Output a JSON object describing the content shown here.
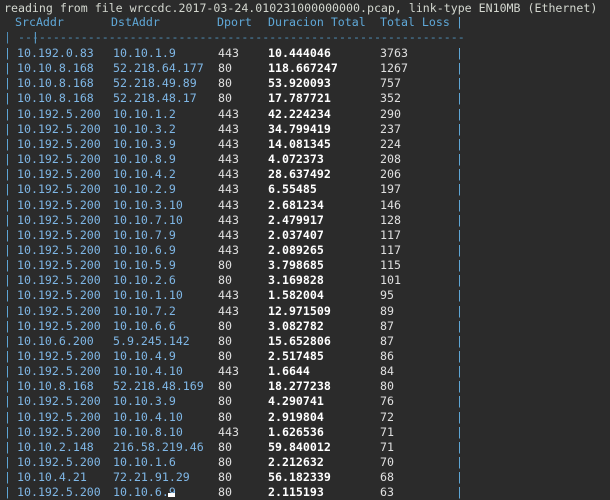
{
  "terminal": {
    "status_line": "reading from file wrccdc.2017-03-24.010231000000000.pcap, link-type EN10MB (Ethernet)",
    "separator": "| -------------------------------------------------------------------------------- |"
  },
  "table": {
    "headers": {
      "src": "SrcAddr",
      "dst": "DstAddr",
      "port": "Dport",
      "dur": "Duracion Total",
      "loss": "Total Loss"
    },
    "rows": [
      {
        "src": "10.192.0.83",
        "dst": "10.10.1.9",
        "port": "443",
        "dur": "10.444046",
        "loss": "3763"
      },
      {
        "src": "10.10.8.168",
        "dst": "52.218.64.177",
        "port": "80",
        "dur": "118.667247",
        "loss": "1267"
      },
      {
        "src": "10.10.8.168",
        "dst": "52.218.49.89",
        "port": "80",
        "dur": "53.920093",
        "loss": "757"
      },
      {
        "src": "10.10.8.168",
        "dst": "52.218.48.17",
        "port": "80",
        "dur": "17.787721",
        "loss": "352"
      },
      {
        "src": "10.192.5.200",
        "dst": "10.10.1.2",
        "port": "443",
        "dur": "42.224234",
        "loss": "290"
      },
      {
        "src": "10.192.5.200",
        "dst": "10.10.3.2",
        "port": "443",
        "dur": "34.799419",
        "loss": "237"
      },
      {
        "src": "10.192.5.200",
        "dst": "10.10.3.9",
        "port": "443",
        "dur": "14.081345",
        "loss": "224"
      },
      {
        "src": "10.192.5.200",
        "dst": "10.10.8.9",
        "port": "443",
        "dur": "4.072373",
        "loss": "208"
      },
      {
        "src": "10.192.5.200",
        "dst": "10.10.4.2",
        "port": "443",
        "dur": "28.637492",
        "loss": "206"
      },
      {
        "src": "10.192.5.200",
        "dst": "10.10.2.9",
        "port": "443",
        "dur": "6.55485",
        "loss": "197"
      },
      {
        "src": "10.192.5.200",
        "dst": "10.10.3.10",
        "port": "443",
        "dur": "2.681234",
        "loss": "146"
      },
      {
        "src": "10.192.5.200",
        "dst": "10.10.7.10",
        "port": "443",
        "dur": "2.479917",
        "loss": "128"
      },
      {
        "src": "10.192.5.200",
        "dst": "10.10.7.9",
        "port": "443",
        "dur": "2.037407",
        "loss": "117"
      },
      {
        "src": "10.192.5.200",
        "dst": "10.10.6.9",
        "port": "443",
        "dur": "2.089265",
        "loss": "117"
      },
      {
        "src": "10.192.5.200",
        "dst": "10.10.5.9",
        "port": "80",
        "dur": "3.798685",
        "loss": "115"
      },
      {
        "src": "10.192.5.200",
        "dst": "10.10.2.6",
        "port": "80",
        "dur": "3.169828",
        "loss": "101"
      },
      {
        "src": "10.192.5.200",
        "dst": "10.10.1.10",
        "port": "443",
        "dur": "1.582004",
        "loss": "95"
      },
      {
        "src": "10.192.5.200",
        "dst": "10.10.7.2",
        "port": "443",
        "dur": "12.971509",
        "loss": "89"
      },
      {
        "src": "10.192.5.200",
        "dst": "10.10.6.6",
        "port": "80",
        "dur": "3.082782",
        "loss": "87"
      },
      {
        "src": "10.10.6.200",
        "dst": "5.9.245.142",
        "port": "80",
        "dur": "15.652806",
        "loss": "87"
      },
      {
        "src": "10.192.5.200",
        "dst": "10.10.4.9",
        "port": "80",
        "dur": "2.517485",
        "loss": "86"
      },
      {
        "src": "10.192.5.200",
        "dst": "10.10.4.10",
        "port": "443",
        "dur": "1.6644",
        "loss": "84"
      },
      {
        "src": "10.10.8.168",
        "dst": "52.218.48.169",
        "port": "80",
        "dur": "18.277238",
        "loss": "80"
      },
      {
        "src": "10.192.5.200",
        "dst": "10.10.3.9",
        "port": "80",
        "dur": "4.290741",
        "loss": "76"
      },
      {
        "src": "10.192.5.200",
        "dst": "10.10.4.10",
        "port": "80",
        "dur": "2.919804",
        "loss": "72"
      },
      {
        "src": "10.192.5.200",
        "dst": "10.10.8.10",
        "port": "443",
        "dur": "1.626536",
        "loss": "71"
      },
      {
        "src": "10.10.2.148",
        "dst": "216.58.219.46",
        "port": "80",
        "dur": "59.840012",
        "loss": "71"
      },
      {
        "src": "10.192.5.200",
        "dst": "10.10.1.6",
        "port": "80",
        "dur": "2.212632",
        "loss": "70"
      },
      {
        "src": "10.10.4.21",
        "dst": "72.21.91.29",
        "port": "80",
        "dur": "56.182339",
        "loss": "68"
      },
      {
        "src": "10.192.5.200",
        "dst": "10.10.6.9",
        "port": "80",
        "dur": "2.115193",
        "loss": "63"
      }
    ]
  }
}
